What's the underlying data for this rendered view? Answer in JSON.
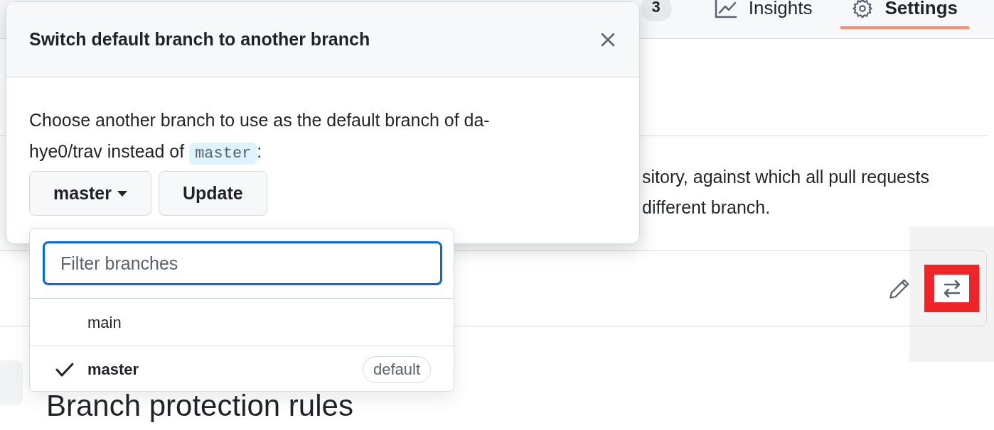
{
  "nav": {
    "counter": "3",
    "tabs": [
      {
        "label": "Insights",
        "kind": "graph",
        "selected": false
      },
      {
        "label": "Settings",
        "kind": "gear",
        "selected": true
      }
    ]
  },
  "default_branch": {
    "description_lines": [
      "sitory, against which all pull requests",
      "different branch."
    ]
  },
  "section_heading": "Branch protection rules",
  "dialog": {
    "title": "Switch default branch to another branch",
    "message": "Choose another branch to use as the default branch of da-hye0/trav instead of ",
    "current_branch": "master",
    "message_end": ":",
    "branch_button": "master",
    "update_button": "Update"
  },
  "branch_menu": {
    "filter_placeholder": "Filter branches",
    "branches": [
      {
        "name": "main",
        "selected": false
      },
      {
        "name": "master",
        "selected": true,
        "badge": "default"
      }
    ]
  }
}
